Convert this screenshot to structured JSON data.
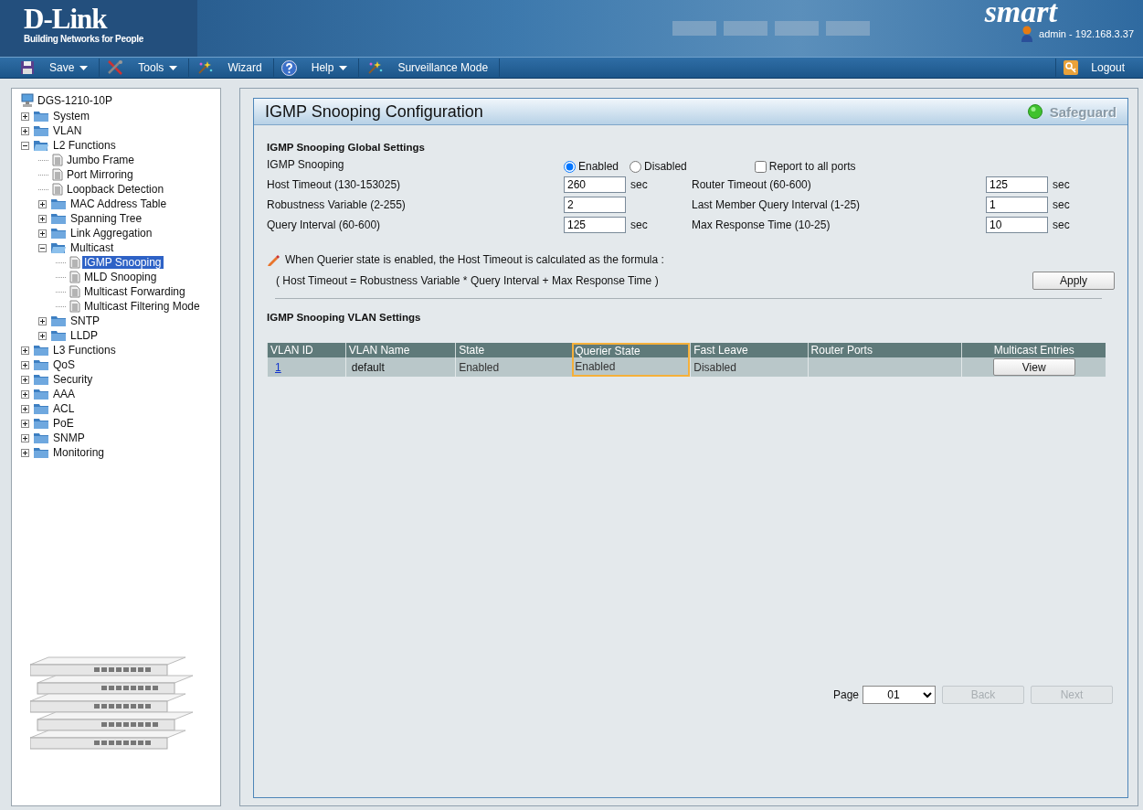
{
  "header": {
    "logo": "D-Link",
    "tagline": "Building Networks for People",
    "product_logo": "smart",
    "user": "admin - 192.168.3.37"
  },
  "menu": {
    "items": [
      {
        "label": "Save",
        "kind": "save",
        "dropdown": true
      },
      {
        "label": "Tools",
        "kind": "tools",
        "dropdown": true
      },
      {
        "label": "Wizard",
        "kind": "wizard",
        "dropdown": false
      },
      {
        "label": "Help",
        "kind": "help",
        "dropdown": true
      },
      {
        "label": "Surveillance Mode",
        "kind": "wizard",
        "dropdown": false
      }
    ],
    "logout": "Logout"
  },
  "tree": {
    "root": "DGS-1210-10P",
    "items": [
      {
        "label": "System",
        "kind": "folder",
        "expanded": false,
        "selected": false
      },
      {
        "label": "VLAN",
        "kind": "folder",
        "expanded": false,
        "selected": false
      },
      {
        "label": "L2 Functions",
        "kind": "folder",
        "expanded": true,
        "selected": false,
        "children": [
          {
            "label": "Jumbo Frame",
            "kind": "page",
            "selected": false
          },
          {
            "label": "Port Mirroring",
            "kind": "page",
            "selected": false
          },
          {
            "label": "Loopback Detection",
            "kind": "page",
            "selected": false
          },
          {
            "label": "MAC Address Table",
            "kind": "folder",
            "expanded": false,
            "selected": false
          },
          {
            "label": "Spanning Tree",
            "kind": "folder",
            "expanded": false,
            "selected": false
          },
          {
            "label": "Link Aggregation",
            "kind": "folder",
            "expanded": false,
            "selected": false
          },
          {
            "label": "Multicast",
            "kind": "folder",
            "expanded": true,
            "selected": false,
            "children": [
              {
                "label": "IGMP Snooping",
                "kind": "page",
                "selected": true
              },
              {
                "label": "MLD Snooping",
                "kind": "page",
                "selected": false
              },
              {
                "label": "Multicast Forwarding",
                "kind": "page",
                "selected": false
              },
              {
                "label": "Multicast Filtering Mode",
                "kind": "page",
                "selected": false
              }
            ]
          },
          {
            "label": "SNTP",
            "kind": "folder",
            "expanded": false,
            "selected": false
          },
          {
            "label": "LLDP",
            "kind": "folder",
            "expanded": false,
            "selected": false
          }
        ]
      },
      {
        "label": "L3 Functions",
        "kind": "folder",
        "expanded": false,
        "selected": false
      },
      {
        "label": "QoS",
        "kind": "folder",
        "expanded": false,
        "selected": false
      },
      {
        "label": "Security",
        "kind": "folder",
        "expanded": false,
        "selected": false
      },
      {
        "label": "AAA",
        "kind": "folder",
        "expanded": false,
        "selected": false
      },
      {
        "label": "ACL",
        "kind": "folder",
        "expanded": false,
        "selected": false
      },
      {
        "label": "PoE",
        "kind": "folder",
        "expanded": false,
        "selected": false
      },
      {
        "label": "SNMP",
        "kind": "folder",
        "expanded": false,
        "selected": false
      },
      {
        "label": "Monitoring",
        "kind": "folder",
        "expanded": false,
        "selected": false
      }
    ]
  },
  "panel": {
    "title": "IGMP Snooping Configuration",
    "safeguard": "Safeguard",
    "global_title": "IGMP Snooping Global Settings",
    "snooping": {
      "label": "IGMP Snooping",
      "options": [
        {
          "label": "Enabled",
          "selected": true
        },
        {
          "label": "Disabled",
          "selected": false
        }
      ],
      "report_all": {
        "label": "Report to all ports",
        "checked": false
      }
    },
    "fields": [
      [
        {
          "label": "Host Timeout (130-153025)",
          "value": "260",
          "unit": "sec"
        },
        {
          "label": "Router Timeout (60-600)",
          "value": "125",
          "unit": "sec"
        }
      ],
      [
        {
          "label": "Robustness Variable (2-255)",
          "value": "2"
        },
        {
          "label": "Last Member Query Interval (1-25)",
          "value": "1",
          "unit": "sec"
        }
      ],
      [
        {
          "label": "Query Interval (60-600)",
          "value": "125",
          "unit": "sec"
        },
        {
          "label": "Max Response Time (10-25)",
          "value": "10",
          "unit": "sec"
        }
      ]
    ],
    "note": "When Querier state is enabled, the Host Timeout is calculated as the formula :",
    "formula": "( Host Timeout = Robustness Variable * Query Interval + Max Response Time )",
    "apply": "Apply",
    "vlan_title": "IGMP Snooping VLAN Settings",
    "table": {
      "columns": [
        {
          "label": "VLAN ID",
          "highlighted": false
        },
        {
          "label": "VLAN Name",
          "highlighted": false
        },
        {
          "label": "State",
          "highlighted": false
        },
        {
          "label": "Querier State",
          "highlighted": true
        },
        {
          "label": "Fast Leave",
          "highlighted": false
        },
        {
          "label": "Router Ports",
          "highlighted": false
        },
        {
          "label": "Multicast Entries",
          "highlighted": false
        }
      ],
      "rows": [
        {
          "vlan_id": "1",
          "vlan_name": "default",
          "state": "Enabled",
          "querier_state": "Enabled",
          "fast_leave": "Disabled",
          "action": "View"
        }
      ]
    },
    "pager": {
      "label": "Page",
      "page": "01",
      "back": {
        "label": "Back",
        "disabled": true
      },
      "next": {
        "label": "Next",
        "disabled": true
      }
    }
  }
}
